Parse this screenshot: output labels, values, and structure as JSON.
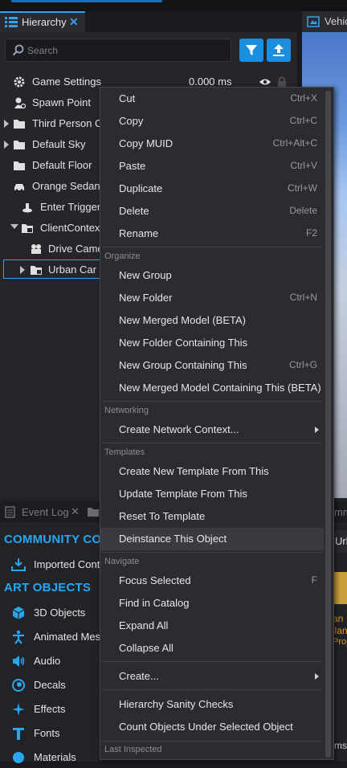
{
  "hierarchy": {
    "tab_label": "Hierarchy",
    "close": "✕",
    "search_placeholder": "Search",
    "rows": [
      {
        "label": "Game Settings",
        "value": "0.000 ms"
      },
      {
        "label": "Spawn Point"
      },
      {
        "label": "Third Person Ca"
      },
      {
        "label": "Default Sky"
      },
      {
        "label": "Default Floor"
      },
      {
        "label": "Orange Sedan"
      },
      {
        "label": "Enter Trigger"
      },
      {
        "label": "ClientContext"
      },
      {
        "label": "Drive Came"
      },
      {
        "label": "Urban Car -"
      }
    ]
  },
  "viewport": {
    "tab_label": "Vehic"
  },
  "bottom": {
    "event_log_tab": "Event Log",
    "close": "✕",
    "community_heading": "COMMUNITY CON",
    "imported_content": "Imported Conte",
    "art_heading": "ART OBJECTS",
    "items": [
      "3D Objects",
      "Animated Mes",
      "Audio",
      "Decals",
      "Effects",
      "Fonts",
      "Materials"
    ],
    "right_fragments": [
      "Urb",
      "an",
      "ilan",
      "Prop",
      "ms",
      "mm"
    ]
  },
  "menu": {
    "items": [
      {
        "label": "Cut",
        "shortcut": "Ctrl+X"
      },
      {
        "label": "Copy",
        "shortcut": "Ctrl+C"
      },
      {
        "label": "Copy MUID",
        "shortcut": "Ctrl+Alt+C"
      },
      {
        "label": "Paste",
        "shortcut": "Ctrl+V"
      },
      {
        "label": "Duplicate",
        "shortcut": "Ctrl+W"
      },
      {
        "label": "Delete",
        "shortcut": "Delete"
      },
      {
        "label": "Rename",
        "shortcut": "F2"
      }
    ],
    "organize_header": "Organize",
    "organize": [
      {
        "label": "New Group",
        "shortcut": ""
      },
      {
        "label": "New Folder",
        "shortcut": "Ctrl+N"
      },
      {
        "label": "New Merged Model (BETA)",
        "shortcut": ""
      },
      {
        "label": "New Folder Containing This",
        "shortcut": ""
      },
      {
        "label": "New Group Containing This",
        "shortcut": "Ctrl+G"
      },
      {
        "label": "New Merged Model Containing This (BETA)",
        "shortcut": ""
      }
    ],
    "networking_header": "Networking",
    "networking": [
      {
        "label": "Create Network Context..."
      }
    ],
    "templates_header": "Templates",
    "templates": [
      {
        "label": "Create New Template From This"
      },
      {
        "label": "Update Template From This"
      },
      {
        "label": "Reset To Template"
      },
      {
        "label": "Deinstance This Object"
      }
    ],
    "navigate_header": "Navigate",
    "navigate": [
      {
        "label": "Focus Selected",
        "shortcut": "F"
      },
      {
        "label": "Find in Catalog",
        "shortcut": ""
      },
      {
        "label": "Expand All",
        "shortcut": ""
      },
      {
        "label": "Collapse All",
        "shortcut": ""
      }
    ],
    "create": "Create...",
    "hierarchy_checks": "Hierarchy Sanity Checks",
    "count_objects": "Count Objects Under Selected Object",
    "last_inspected_header": "Last Inspected"
  },
  "colors": {
    "accent": "#1a8fe0",
    "menu_bg": "#2b2c30",
    "panel_bg": "#25262b",
    "highlight": "#3a3b41"
  }
}
